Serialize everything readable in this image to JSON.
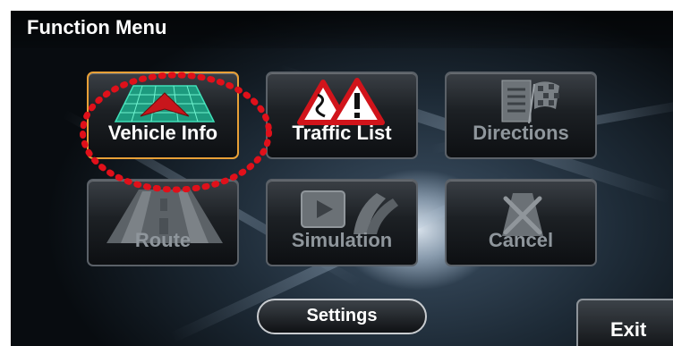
{
  "header": {
    "title": "Function Menu"
  },
  "menu": {
    "items": [
      {
        "label": "Vehicle Info",
        "icon": "vehicle-info-grid-icon",
        "enabled": true,
        "selected": true
      },
      {
        "label": "Traffic List",
        "icon": "traffic-warning-icon",
        "enabled": true,
        "selected": false
      },
      {
        "label": "Directions",
        "icon": "directions-list-flag-icon",
        "enabled": false,
        "selected": false
      },
      {
        "label": "Route",
        "icon": "route-road-icon",
        "enabled": false,
        "selected": false
      },
      {
        "label": "Simulation",
        "icon": "simulation-play-icon",
        "enabled": false,
        "selected": false
      },
      {
        "label": "Cancel",
        "icon": "cancel-route-icon",
        "enabled": false,
        "selected": false
      }
    ]
  },
  "footer": {
    "settings_label": "Settings",
    "exit_label": "Exit"
  },
  "colors": {
    "selected_border": "#e8a037",
    "highlight": "#e0101a",
    "disabled_text": "#8f969c"
  }
}
